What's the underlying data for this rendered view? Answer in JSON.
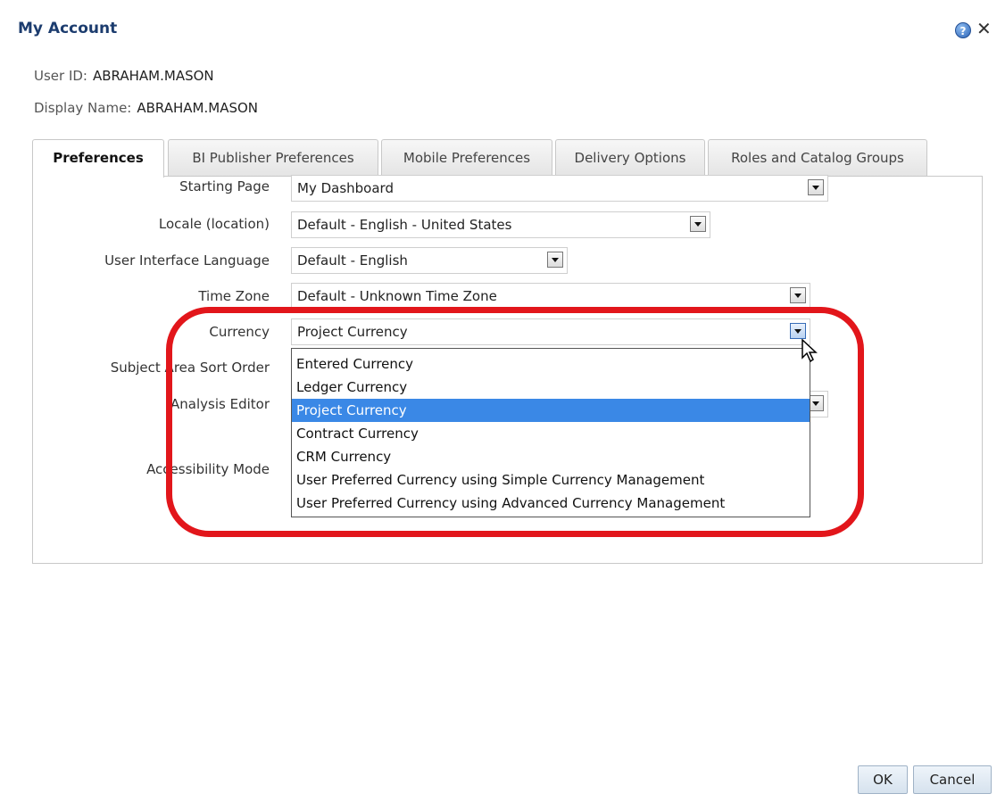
{
  "dialog": {
    "title": "My Account",
    "help_icon": "help-icon",
    "close_icon": "close-icon"
  },
  "user": {
    "id_label": "User ID:",
    "id_value": "ABRAHAM.MASON",
    "display_label": "Display Name:",
    "display_value": "ABRAHAM.MASON"
  },
  "tabs": [
    {
      "label": "Preferences",
      "active": true
    },
    {
      "label": "BI Publisher Preferences",
      "active": false
    },
    {
      "label": "Mobile Preferences",
      "active": false
    },
    {
      "label": "Delivery Options",
      "active": false
    },
    {
      "label": "Roles and Catalog Groups",
      "active": false
    }
  ],
  "preferences": {
    "starting_page": {
      "label": "Starting Page",
      "value": "My Dashboard"
    },
    "locale": {
      "label": "Locale (location)",
      "value": "Default - English - United States"
    },
    "ui_language": {
      "label": "User Interface Language",
      "value": "Default - English"
    },
    "time_zone": {
      "label": "Time Zone",
      "value": "Default - Unknown Time Zone"
    },
    "currency": {
      "label": "Currency",
      "value": "Project Currency"
    },
    "subject_area_sort": {
      "label": "Subject Area Sort Order"
    },
    "analysis_editor": {
      "label": "Analysis Editor"
    },
    "accessibility_mode": {
      "label": "Accessibility Mode"
    }
  },
  "currency_options": [
    "Entered Currency",
    "Ledger Currency",
    "Project Currency",
    "Contract Currency",
    "CRM Currency",
    "User Preferred Currency using Simple Currency Management",
    "User Preferred Currency using Advanced Currency Management"
  ],
  "selected_option_index": 2,
  "buttons": {
    "ok": "OK",
    "cancel": "Cancel"
  },
  "colors": {
    "highlight": "#e2161b",
    "selection": "#3a88e6",
    "title": "#1c3c6e"
  }
}
